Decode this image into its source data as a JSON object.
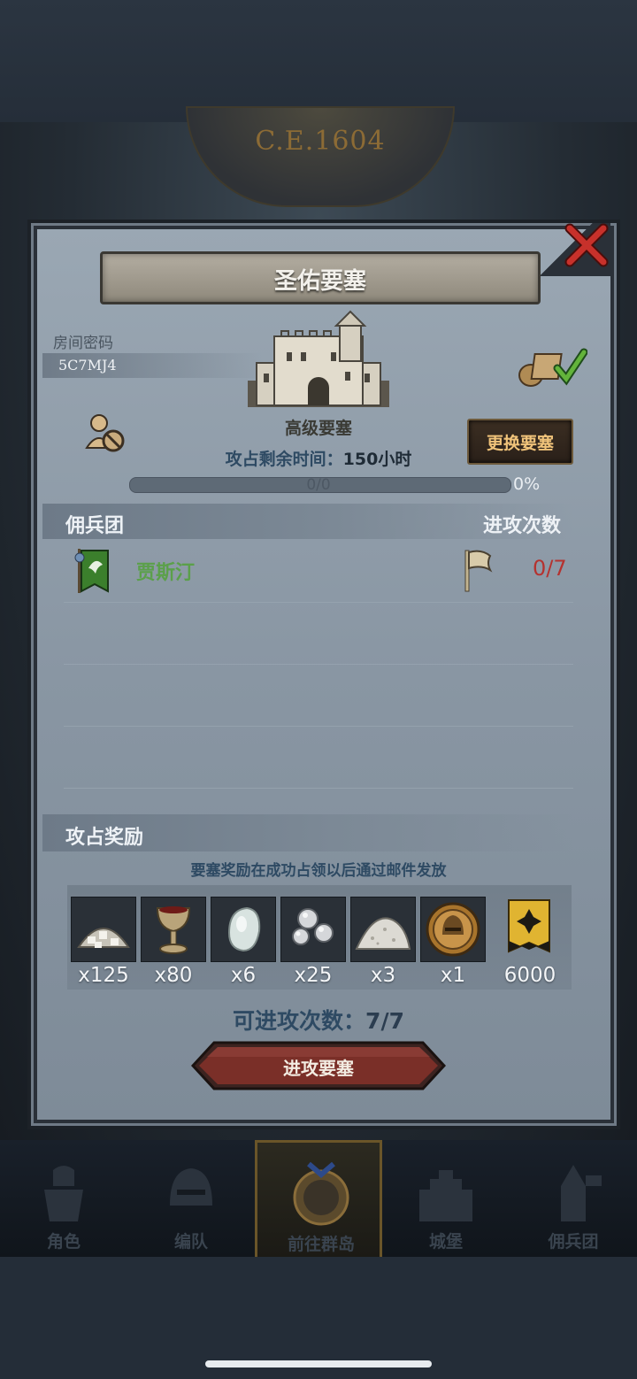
{
  "header": {
    "era_label": "C.E.1604"
  },
  "modal": {
    "title": "圣佑要塞",
    "room_code_label": "房间密码",
    "room_code": "5C7MJ4",
    "fortress_grade": "高级要塞",
    "change_fortress_label": "更换要塞",
    "time_label": "攻占剩余时间：",
    "time_value": "150小时",
    "progress_count": "0/0",
    "progress_percent": "0%",
    "progress_fraction": 0
  },
  "mercenary": {
    "header_label": "佣兵团",
    "attack_count_label": "进攻次数",
    "rows": [
      {
        "name": "贾斯汀",
        "attempts": "0/7"
      }
    ]
  },
  "rewards": {
    "header_label": "攻占奖励",
    "note": "要塞奖励在成功占领以后通过邮件发放",
    "items": [
      {
        "icon": "ore-pile-icon",
        "qty": "x125"
      },
      {
        "icon": "goblet-icon",
        "qty": "x80"
      },
      {
        "icon": "moonstone-icon",
        "qty": "x6"
      },
      {
        "icon": "silver-pearls-icon",
        "qty": "x25"
      },
      {
        "icon": "salt-pile-icon",
        "qty": "x3"
      },
      {
        "icon": "helmet-medal-icon",
        "qty": "x1"
      },
      {
        "icon": "banner-emblem-icon",
        "qty": "6000"
      }
    ]
  },
  "attempts_left_label": "可进攻次数：",
  "attempts_left_value": "7/7",
  "attack_button_label": "进攻要塞",
  "nav": {
    "items": [
      {
        "label": "角色",
        "icon": "knight-icon"
      },
      {
        "label": "编队",
        "icon": "helmet-icon"
      },
      {
        "label": "前往群岛",
        "icon": "compass-icon"
      },
      {
        "label": "城堡",
        "icon": "castle-icon"
      },
      {
        "label": "佣兵团",
        "icon": "tower-icon"
      }
    ],
    "active_index": 2
  },
  "colors": {
    "accent_gold": "#f0c37a",
    "merc_green": "#5ba04a",
    "attempts_red": "#b5322f",
    "slate_text": "#2e4a63"
  }
}
